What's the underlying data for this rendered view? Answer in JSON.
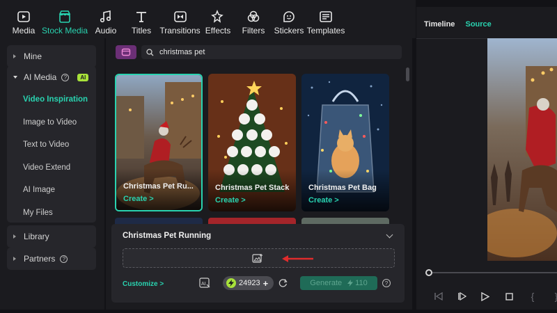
{
  "toolbar": {
    "items": [
      {
        "label": "Media",
        "icon": "media-icon"
      },
      {
        "label": "Stock Media",
        "icon": "stock-media-icon"
      },
      {
        "label": "Audio",
        "icon": "music-note-icon"
      },
      {
        "label": "Titles",
        "icon": "text-t-icon"
      },
      {
        "label": "Transitions",
        "icon": "transitions-icon"
      },
      {
        "label": "Effects",
        "icon": "effects-sparkle-icon"
      },
      {
        "label": "Filters",
        "icon": "filters-icon"
      },
      {
        "label": "Stickers",
        "icon": "sticker-icon"
      },
      {
        "label": "Templates",
        "icon": "templates-icon"
      }
    ],
    "active": "Stock Media",
    "accent": "#29d3b0"
  },
  "sidebar": {
    "mine": "Mine",
    "ai_media": "AI Media",
    "ai_badge": "AI",
    "sub_items": [
      "Video Inspiration",
      "Image to Video",
      "Text to Video",
      "Video Extend",
      "AI Image",
      "My Files"
    ],
    "active_sub": "Video Inspiration",
    "library": "Library",
    "partners": "Partners"
  },
  "search": {
    "value": "christmas pet"
  },
  "cards": [
    {
      "title": "Christmas Pet Ru...",
      "action": "Create >"
    },
    {
      "title": "Christmas Pet Stack",
      "action": "Create >"
    },
    {
      "title": "Christmas Pet Bag",
      "action": "Create >"
    }
  ],
  "panel": {
    "title": "Christmas Pet Running",
    "customize": "Customize  >",
    "credits": "24923",
    "generate": "Generate",
    "cost": "110"
  },
  "preview": {
    "tabs": [
      "Timeline",
      "Source"
    ],
    "active_tab": "Source"
  }
}
